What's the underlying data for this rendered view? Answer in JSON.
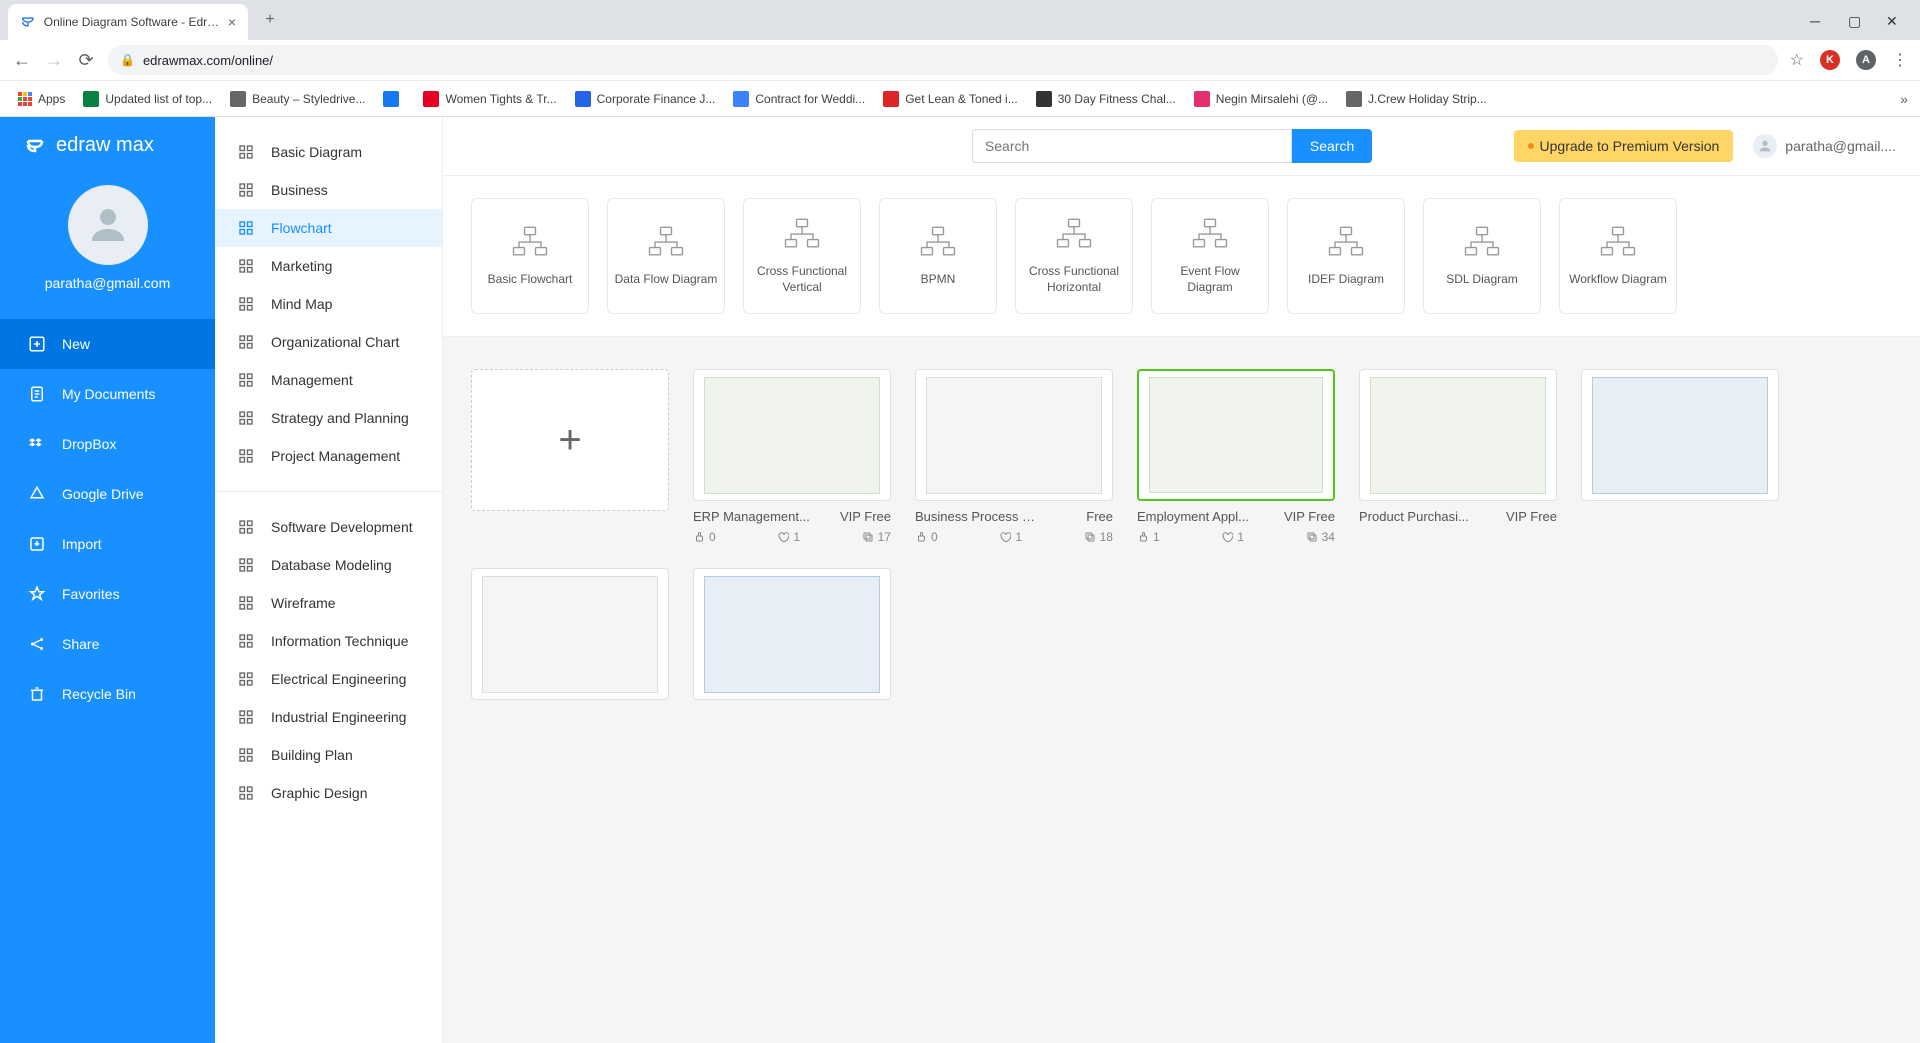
{
  "browser": {
    "tab_title": "Online Diagram Software - Edraw",
    "url": "edrawmax.com/online/",
    "bookmarks": [
      {
        "label": "Apps",
        "icon": "apps"
      },
      {
        "label": "Updated list of top...",
        "color": "#0b8043"
      },
      {
        "label": "Beauty – Styledrive...",
        "color": "#666"
      },
      {
        "label": "",
        "color": "#1877f2"
      },
      {
        "label": "Women Tights & Tr...",
        "color": "#e60023"
      },
      {
        "label": "Corporate Finance J...",
        "color": "#2563eb"
      },
      {
        "label": "Contract for Weddi...",
        "color": "#3b82f6"
      },
      {
        "label": "Get Lean & Toned i...",
        "color": "#dc2626"
      },
      {
        "label": "30 Day Fitness Chal...",
        "color": "#333"
      },
      {
        "label": "Negin Mirsalehi (@...",
        "color": "#e1306c"
      },
      {
        "label": "J.Crew Holiday Strip...",
        "color": "#666"
      }
    ]
  },
  "app": {
    "logo": "edraw max",
    "user_email": "paratha@gmail.com",
    "user_email_top": "paratha@gmail....",
    "nav": [
      {
        "label": "New",
        "icon": "plus-square",
        "active": true
      },
      {
        "label": "My Documents",
        "icon": "doc"
      },
      {
        "label": "DropBox",
        "icon": "dropbox"
      },
      {
        "label": "Google Drive",
        "icon": "drive"
      },
      {
        "label": "Import",
        "icon": "import"
      },
      {
        "label": "Favorites",
        "icon": "star"
      },
      {
        "label": "Share",
        "icon": "share"
      },
      {
        "label": "Recycle Bin",
        "icon": "trash"
      }
    ],
    "categories_a": [
      {
        "label": "Basic Diagram"
      },
      {
        "label": "Business"
      },
      {
        "label": "Flowchart",
        "active": true
      },
      {
        "label": "Marketing"
      },
      {
        "label": "Mind Map"
      },
      {
        "label": "Organizational Chart"
      },
      {
        "label": "Management"
      },
      {
        "label": "Strategy and Planning"
      },
      {
        "label": "Project Management"
      }
    ],
    "categories_b": [
      {
        "label": "Software Development"
      },
      {
        "label": "Database Modeling"
      },
      {
        "label": "Wireframe"
      },
      {
        "label": "Information Technique"
      },
      {
        "label": "Electrical Engineering"
      },
      {
        "label": "Industrial Engineering"
      },
      {
        "label": "Building Plan"
      },
      {
        "label": "Graphic Design"
      }
    ],
    "search_placeholder": "Search",
    "search_button": "Search",
    "upgrade": "Upgrade to Premium Version",
    "templates": [
      {
        "label": "Basic Flowchart"
      },
      {
        "label": "Data Flow Diagram"
      },
      {
        "label": "Cross Functional Vertical"
      },
      {
        "label": "BPMN"
      },
      {
        "label": "Cross Functional Horizontal"
      },
      {
        "label": "Event Flow Diagram"
      },
      {
        "label": "IDEF Diagram"
      },
      {
        "label": "SDL Diagram"
      },
      {
        "label": "Workflow Diagram"
      }
    ],
    "examples": [
      {
        "title": "ERP Management...",
        "badge": "VIP Free",
        "likes": "0",
        "hearts": "1",
        "copies": "17",
        "type": "green"
      },
      {
        "title": "Business Process Mo...",
        "badge": "Free",
        "likes": "0",
        "hearts": "1",
        "copies": "18",
        "type": "gray"
      },
      {
        "title": "Employment Appl...",
        "badge": "VIP Free",
        "likes": "1",
        "hearts": "1",
        "copies": "34",
        "type": "green",
        "selected": true
      },
      {
        "title": "Product Purchasi...",
        "badge": "VIP Free",
        "type": "green",
        "partial": true
      },
      {
        "title": "",
        "badge": "",
        "type": "blue",
        "partial": true
      },
      {
        "title": "",
        "badge": "",
        "type": "gray",
        "partial": true
      },
      {
        "title": "",
        "badge": "",
        "type": "blue",
        "partial": true
      }
    ]
  }
}
